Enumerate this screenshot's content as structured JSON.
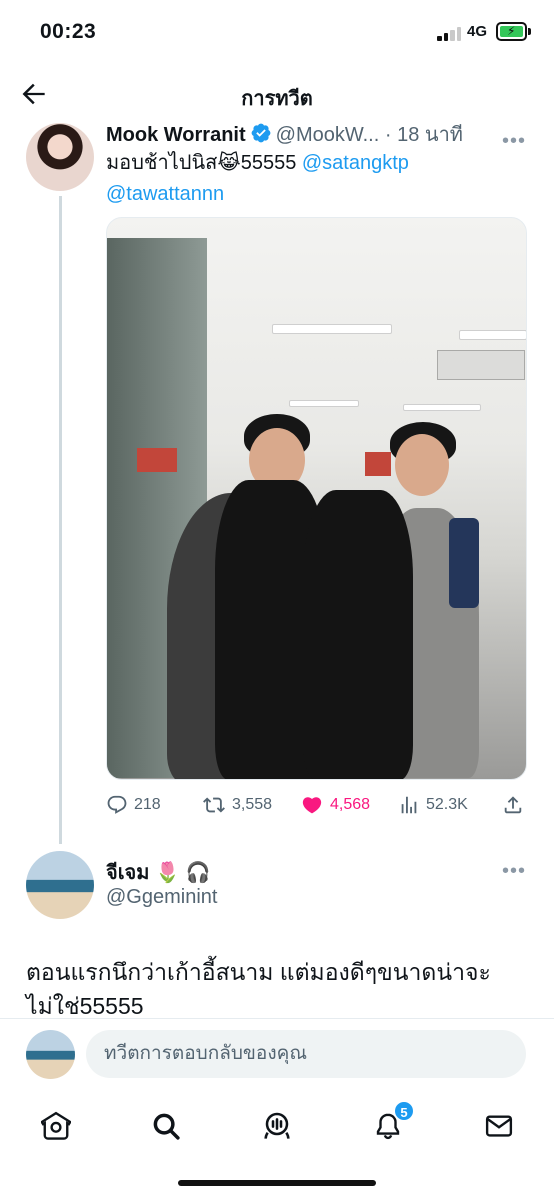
{
  "status_bar": {
    "time": "00:23",
    "network": "4G"
  },
  "header": {
    "title": "การทวีต"
  },
  "tweet": {
    "display_name": "Mook Worranit",
    "handle": "@MookW...",
    "separator": "·",
    "time_ago": "18 นาที",
    "text_before": "มอบช้าไปนิส😹55555 ",
    "mention_1": "@satangktp",
    "mention_2": "@tawattannn",
    "replies": "218",
    "retweets": "3,558",
    "likes": "4,568",
    "views": "52.3K"
  },
  "reply": {
    "display_name": "จีเจม",
    "name_emoji": "🌷 🎧",
    "handle": "@Ggeminint",
    "text": "ตอนแรกนึกว่าเก้าอี้สนาม แต่มองดีๆขนาดน่าจะไม่ใช่55555"
  },
  "compose": {
    "placeholder": "ทวีตการตอบกลับของคุณ"
  },
  "nav": {
    "notification_count": "5"
  },
  "colors": {
    "accent": "#1d9bf0",
    "like": "#f91880",
    "verified": "#1d9bf0",
    "battery": "#34c759"
  },
  "icons": {
    "back": "arrow-left-icon",
    "verified": "verified-badge-icon",
    "more": "more-horizontal-icon",
    "reply": "reply-icon",
    "retweet": "retweet-icon",
    "like": "heart-icon",
    "views": "views-icon",
    "share": "share-icon",
    "home": "home-icon",
    "search": "search-icon",
    "spaces": "spaces-icon",
    "notifications": "bell-icon",
    "messages": "mail-icon"
  }
}
